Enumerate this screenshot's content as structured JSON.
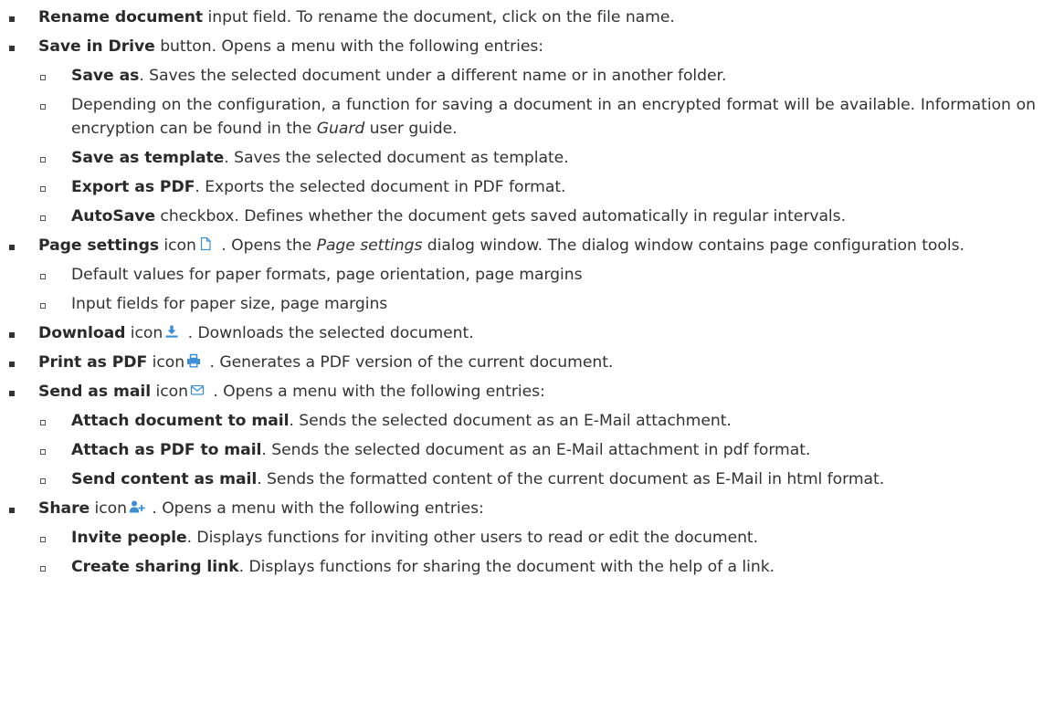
{
  "colors": {
    "text": "#333333",
    "icon_blue": "#3c8fd6"
  },
  "items": [
    {
      "bold": "Rename document",
      "text": " input field. To rename the document, click on the file name."
    },
    {
      "bold": "Save in Drive",
      "text": " button. Opens a menu with the following entries:",
      "sub": [
        {
          "bold": "Save as",
          "text": ". Saves the selected document under a different name or in another folder."
        },
        {
          "pre": "Depending on the configuration, a function for saving a document in an encrypted format will be available. Information on encryption can be found in the ",
          "italic": "Guard",
          "post": " user guide."
        },
        {
          "bold": "Save as template",
          "text": ". Saves the selected document as template."
        },
        {
          "bold": "Export as PDF",
          "text": ". Exports the selected document in PDF format."
        },
        {
          "bold": "AutoSave",
          "text": " checkbox. Defines whether the document gets saved automatically in regular intervals."
        }
      ]
    },
    {
      "bold": "Page settings",
      "icon_prefix": " icon",
      "icon": "page-settings-icon",
      "pre": " . Opens the ",
      "italic": "Page settings",
      "post": " dialog window. The dialog window contains page configuration tools.",
      "sub": [
        {
          "text": "Default values for paper formats, page orientation, page margins"
        },
        {
          "text": "Input fields for paper size, page margins"
        }
      ]
    },
    {
      "bold": "Download",
      "icon_prefix": " icon",
      "icon": "download-icon",
      "text": " . Downloads the selected document."
    },
    {
      "bold": "Print as PDF",
      "icon_prefix": " icon",
      "icon": "print-icon",
      "text": " . Generates a PDF version of the current document."
    },
    {
      "bold": "Send as mail",
      "icon_prefix": " icon",
      "icon": "mail-icon",
      "text": " . Opens a menu with the following entries:",
      "sub": [
        {
          "bold": "Attach document to mail",
          "text": ". Sends the selected document as an E-Mail attachment."
        },
        {
          "bold": "Attach as PDF to mail",
          "text": ". Sends the selected document as an E-Mail attachment in pdf format."
        },
        {
          "bold": "Send content as mail",
          "text": ". Sends the formatted content of the current document as E-Mail in html format."
        }
      ]
    },
    {
      "bold": "Share",
      "icon_prefix": " icon",
      "icon": "share-user-add-icon",
      "text": " . Opens a menu with the following entries:",
      "sub": [
        {
          "bold": "Invite people",
          "text": ". Displays functions for inviting other users to read or edit the document."
        },
        {
          "bold": "Create sharing link",
          "text": ". Displays functions for sharing the document with the help of a link."
        }
      ]
    }
  ]
}
